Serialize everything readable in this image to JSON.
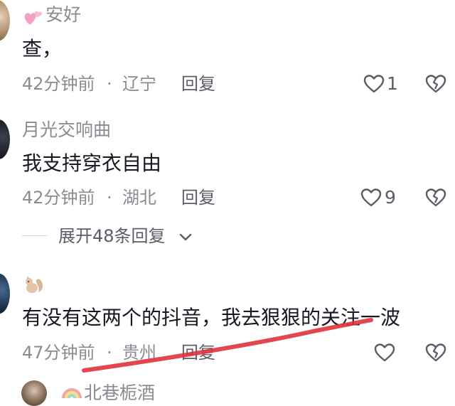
{
  "comments": [
    {
      "username": "安好",
      "username_prefix_icon": "pink-hearts-emoji",
      "text": "查，",
      "time": "42分钟前",
      "location": "辽宁",
      "reply_label": "回复",
      "likes": "1"
    },
    {
      "username": "月光交响曲",
      "text": "我支持穿衣自由",
      "time": "42分钟前",
      "location": "湖北",
      "reply_label": "回复",
      "likes": "9"
    },
    {
      "username_icon": "squirrel-emoji",
      "text": "有没有这两个的抖音，我去狠狠的关注一波",
      "time": "47分钟前",
      "location": "贵州",
      "reply_label": "回复",
      "likes": ""
    },
    {
      "username_prefix_icon": "rainbow-emoji",
      "username": "北巷栀酒"
    }
  ],
  "expand_replies": "展开48条回复",
  "separator": "·",
  "colors": {
    "text": "#161823",
    "meta": "#8a8b91",
    "annotation_stroke": "#e0323c"
  }
}
